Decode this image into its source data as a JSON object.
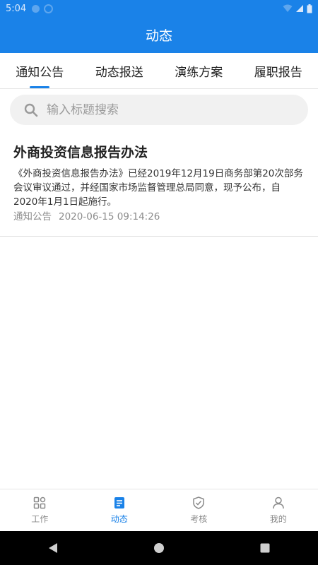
{
  "status_bar": {
    "time": "5:04"
  },
  "app_bar": {
    "title": "动态"
  },
  "tabs": [
    {
      "label": "通知公告",
      "active": true
    },
    {
      "label": "动态报送",
      "active": false
    },
    {
      "label": "演练方案",
      "active": false
    },
    {
      "label": "履职报告",
      "active": false
    }
  ],
  "search": {
    "placeholder": "输入标题搜索",
    "icon": "search-icon"
  },
  "articles": [
    {
      "title": "外商投资信息报告办法",
      "summary": "《外商投资信息报告办法》已经2019年12月19日商务部第20次部务会议审议通过，并经国家市场监督管理总局同意，现予公布，自2020年1月1日起施行。",
      "category": "通知公告",
      "datetime": "2020-06-15 09:14:26"
    }
  ],
  "bottom_nav": [
    {
      "label": "工作",
      "icon": "grid-icon",
      "active": false
    },
    {
      "label": "动态",
      "icon": "document-icon",
      "active": true
    },
    {
      "label": "考核",
      "icon": "shield-check-icon",
      "active": false
    },
    {
      "label": "我的",
      "icon": "person-icon",
      "active": false
    }
  ],
  "colors": {
    "primary": "#1a82e8",
    "inactive": "#8a8a8a",
    "divider": "#e6e6e6"
  }
}
